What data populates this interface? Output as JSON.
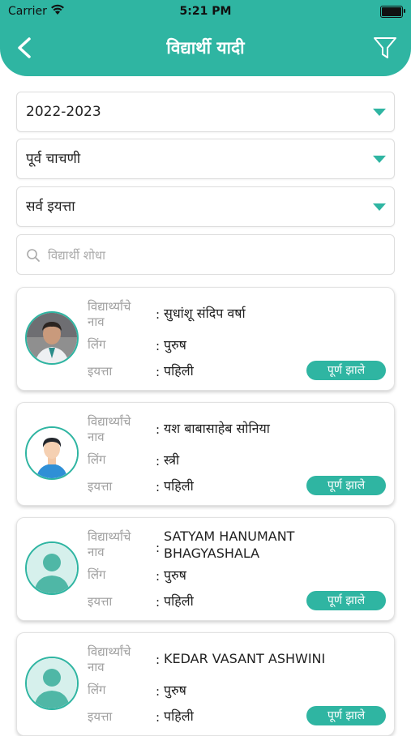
{
  "status_bar": {
    "carrier": "Carrier",
    "time": "5:21 PM"
  },
  "header": {
    "title": "विद्यार्थी यादी"
  },
  "filters": {
    "year": "2022-2023",
    "test": "पूर्व चाचणी",
    "class": "सर्व इयत्ता"
  },
  "search": {
    "placeholder": "विद्यार्थी शोधा"
  },
  "labels": {
    "name": "विद्यार्थ्यांचे\nनाव",
    "gender": "लिंग",
    "grade": "इयत्ता",
    "colon": ":"
  },
  "students": [
    {
      "name": "सुधांशू संदिप वर्षा",
      "gender": "पुरुष",
      "grade": "पहिली",
      "status": "पूर्ण झाले",
      "avatar": "photo"
    },
    {
      "name": "यश बाबासाहेब सोनिया",
      "gender": "स्त्री",
      "grade": "पहिली",
      "status": "पूर्ण झाले",
      "avatar": "male-illustration"
    },
    {
      "name": "SATYAM HANUMANT BHAGYASHALA",
      "gender": "पुरुष",
      "grade": "पहिली",
      "status": "पूर्ण झाले",
      "avatar": "placeholder"
    },
    {
      "name": "KEDAR VASANT ASHWINI",
      "gender": "पुरुष",
      "grade": "पहिली",
      "status": "पूर्ण झाले",
      "avatar": "placeholder"
    }
  ],
  "colors": {
    "accent": "#2fb5a2",
    "label": "#a0a0a0"
  }
}
